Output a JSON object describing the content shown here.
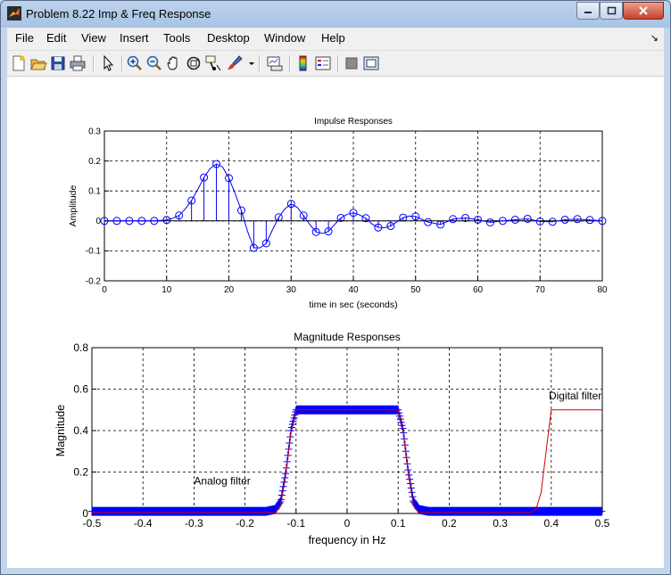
{
  "window": {
    "title": "Problem 8.22 Imp & Freq Response"
  },
  "menu": [
    "File",
    "Edit",
    "View",
    "Insert",
    "Tools",
    "Desktop",
    "Window",
    "Help"
  ],
  "toolbar_icons": [
    "new-figure-icon",
    "open-file-icon",
    "save-icon",
    "print-icon",
    "pointer-icon",
    "zoom-in-icon",
    "zoom-out-icon",
    "pan-hand-icon",
    "rotate-3d-icon",
    "data-cursor-icon",
    "brush-icon",
    "brush-dropdown-icon",
    "link-plot-icon",
    "colorbar-icon",
    "legend-icon",
    "hide-plot-tools-icon",
    "show-plot-tools-icon"
  ],
  "colors": {
    "series": "#0000ff",
    "digital": "#cc0000",
    "grid": "#000000"
  },
  "chart_data": [
    {
      "type": "line",
      "title": "Impulse Responses",
      "xlabel": "time in sec (seconds)",
      "ylabel": "Amplitude",
      "xlim": [
        0,
        80
      ],
      "ylim": [
        -0.2,
        0.3
      ],
      "xticks": [
        "0",
        "10",
        "20",
        "30",
        "40",
        "50",
        "60",
        "70",
        "80"
      ],
      "yticks": [
        "-0.2",
        "-0.1",
        "0",
        "0.1",
        "0.2",
        "0.3"
      ],
      "grid": true,
      "series": [
        {
          "kind": "stem",
          "x": [
            0,
            2,
            4,
            6,
            8,
            10,
            12,
            14,
            16,
            18,
            20,
            22,
            24,
            26,
            28,
            30,
            32,
            34,
            36,
            38,
            40,
            42,
            44,
            46,
            48,
            50,
            52,
            54,
            56,
            58,
            60,
            62,
            64,
            66,
            68,
            70,
            72,
            74,
            76,
            78,
            80
          ],
          "values": [
            0,
            0,
            0,
            0,
            0,
            0.003,
            0.018,
            0.068,
            0.145,
            0.19,
            0.143,
            0.035,
            -0.09,
            -0.075,
            0.012,
            0.057,
            0.018,
            -0.037,
            -0.035,
            0.01,
            0.027,
            0.009,
            -0.022,
            -0.017,
            0.011,
            0.015,
            -0.004,
            -0.012,
            0.006,
            0.01,
            0.004,
            -0.005,
            0,
            0.004,
            0.007,
            -0.002,
            -0.003,
            0.004,
            0.006,
            0.003,
            0
          ]
        },
        {
          "kind": "line",
          "x": [
            0,
            2,
            4,
            6,
            8,
            10,
            11,
            12,
            13,
            14,
            15,
            16,
            17,
            18,
            19,
            20,
            21,
            22,
            23,
            24,
            25,
            26,
            27,
            28,
            29,
            30,
            31,
            32,
            33,
            34,
            35,
            36,
            37,
            38,
            39,
            40,
            41,
            42,
            43,
            44,
            45,
            46,
            47,
            48,
            49,
            50,
            52,
            54,
            56,
            58,
            60,
            62,
            64,
            66,
            68,
            70,
            72,
            74,
            76,
            78,
            80
          ],
          "values": [
            0,
            0,
            0,
            0,
            0,
            0.003,
            0.009,
            0.018,
            0.04,
            0.068,
            0.105,
            0.145,
            0.175,
            0.19,
            0.18,
            0.143,
            0.092,
            0.035,
            -0.035,
            -0.09,
            -0.09,
            -0.075,
            -0.03,
            0.012,
            0.04,
            0.057,
            0.045,
            0.018,
            -0.012,
            -0.037,
            -0.042,
            -0.035,
            -0.012,
            0.01,
            0.022,
            0.027,
            0.02,
            0.009,
            -0.01,
            -0.022,
            -0.023,
            -0.017,
            -0.003,
            0.011,
            0.016,
            0.015,
            -0.004,
            -0.012,
            0.006,
            0.01,
            0.004,
            -0.005,
            0,
            0.004,
            0.007,
            -0.002,
            -0.003,
            0.004,
            0.006,
            0.003,
            0
          ]
        }
      ]
    },
    {
      "type": "line",
      "title": "Magnitude Responses",
      "xlabel": "frequency in Hz",
      "ylabel": "Magnitude",
      "xlim": [
        -0.5,
        0.5
      ],
      "ylim": [
        0,
        0.8
      ],
      "xticks": [
        "-0.5",
        "-0.4",
        "-0.3",
        "-0.2",
        "-0.1",
        "0",
        "0.1",
        "0.2",
        "0.3",
        "0.4",
        "0.5"
      ],
      "yticks": [
        "0",
        "0.2",
        "0.4",
        "0.6",
        "0.8"
      ],
      "grid": true,
      "annotations": [
        {
          "text": "Analog filter",
          "x": -0.3,
          "y": 0.14
        },
        {
          "text": "Digital filter",
          "x": 0.395,
          "y": 0.55
        }
      ],
      "series": [
        {
          "kind": "marker-plus",
          "x": [
            -0.5,
            -0.16,
            -0.14,
            -0.13,
            -0.12,
            -0.11,
            -0.1,
            0.1,
            0.11,
            0.12,
            0.13,
            0.14,
            0.16,
            0.5
          ],
          "values": [
            0.01,
            0.01,
            0.02,
            0.06,
            0.2,
            0.4,
            0.5,
            0.5,
            0.4,
            0.2,
            0.06,
            0.02,
            0.01,
            0.01
          ]
        },
        {
          "kind": "line",
          "x": [
            -0.5,
            -0.14,
            -0.13,
            -0.12,
            -0.11,
            -0.1,
            0.1,
            0.11,
            0.12,
            0.13,
            0.14,
            0.36,
            0.37,
            0.38,
            0.39,
            0.4,
            0.5
          ],
          "values": [
            0.005,
            0.005,
            0.04,
            0.19,
            0.39,
            0.5,
            0.5,
            0.39,
            0.19,
            0.04,
            0.005,
            0.005,
            0.02,
            0.1,
            0.3,
            0.5,
            0.5
          ]
        }
      ]
    }
  ]
}
